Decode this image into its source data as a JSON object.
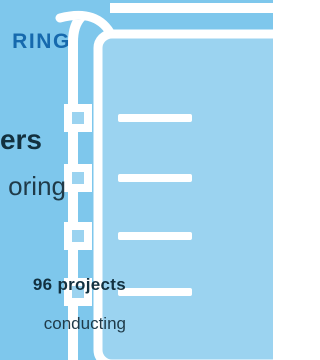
{
  "colors": {
    "background": "#7ec7ec",
    "clipboard_outline": "#ffffff",
    "clipboard_fill": "#9bd3f0",
    "checkbox_fill": "#ffffff",
    "tag_text": "#1669ad",
    "heading_text": "#12303f",
    "body_text": "#1f3a48"
  },
  "tag": {
    "text": "RING"
  },
  "heading": {
    "text": "ers"
  },
  "subheading": {
    "text": "oring"
  },
  "stat": {
    "text": "96 projects"
  },
  "body": {
    "text": "conducting"
  },
  "illustration": {
    "icon": "clipboard-checklist-icon",
    "checklist_rows": 4
  }
}
